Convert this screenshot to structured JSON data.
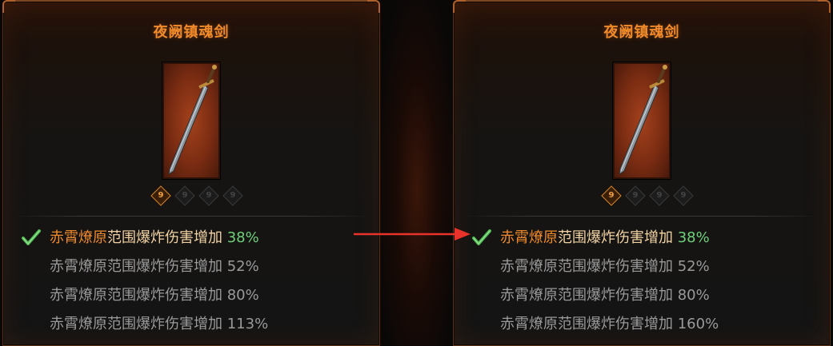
{
  "colors": {
    "title": "#f08a2a",
    "selected_highlight": "#f08a2a",
    "selected_text": "#f3d3a3",
    "selected_value": "#6fd07a",
    "normal_text": "#9a9a9a",
    "arrow": "#e8322a",
    "check": "#4fb84f"
  },
  "left_panel": {
    "title": "夜阙镇魂剑",
    "item_icon": "sword-icon",
    "sockets": [
      {
        "glyph": "9",
        "active": true
      },
      {
        "glyph": "9",
        "active": false
      },
      {
        "glyph": "9",
        "active": false
      },
      {
        "glyph": "9",
        "active": false
      }
    ],
    "affixes": [
      {
        "name_highlight": "赤霄燎原",
        "name_rest": "范围爆炸伤害增加",
        "value": "38%",
        "selected": true
      },
      {
        "name_highlight": "赤霄燎原",
        "name_rest": "范围爆炸伤害增加",
        "value": "52%",
        "selected": false
      },
      {
        "name_highlight": "赤霄燎原",
        "name_rest": "范围爆炸伤害增加",
        "value": "80%",
        "selected": false
      },
      {
        "name_highlight": "赤霄燎原",
        "name_rest": "范围爆炸伤害增加",
        "value": "113%",
        "selected": false
      }
    ]
  },
  "right_panel": {
    "title": "夜阙镇魂剑",
    "item_icon": "sword-icon",
    "sockets": [
      {
        "glyph": "9",
        "active": true
      },
      {
        "glyph": "9",
        "active": false
      },
      {
        "glyph": "9",
        "active": false
      },
      {
        "glyph": "9",
        "active": false
      }
    ],
    "affixes": [
      {
        "name_highlight": "赤霄燎原",
        "name_rest": "范围爆炸伤害增加",
        "value": "38%",
        "selected": true
      },
      {
        "name_highlight": "赤霄燎原",
        "name_rest": "范围爆炸伤害增加",
        "value": "52%",
        "selected": false
      },
      {
        "name_highlight": "赤霄燎原",
        "name_rest": "范围爆炸伤害增加",
        "value": "80%",
        "selected": false
      },
      {
        "name_highlight": "赤霄燎原",
        "name_rest": "范围爆炸伤害增加",
        "value": "160%",
        "selected": false
      }
    ]
  },
  "annotation": {
    "icon": "red-arrow-icon"
  }
}
